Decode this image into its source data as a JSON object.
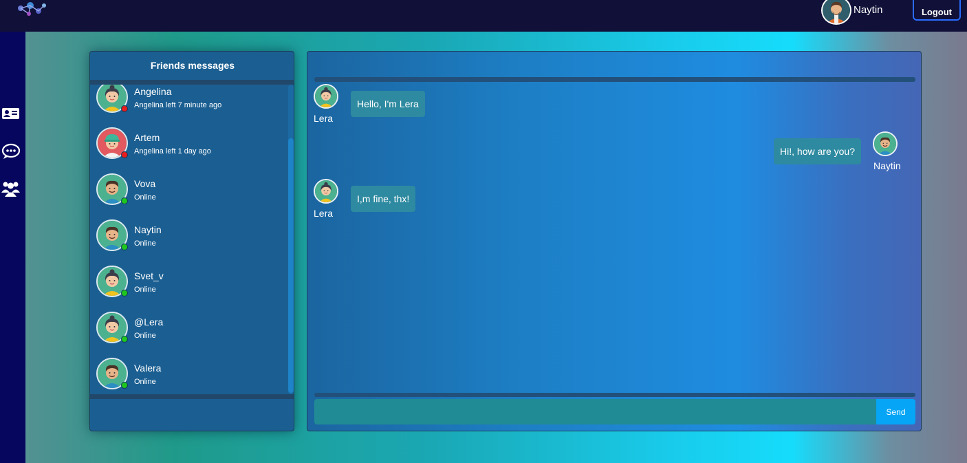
{
  "header": {
    "logo_icon": "network-logo-icon",
    "user_name": "Naytin",
    "logout_label": "Logout"
  },
  "sidebar": {
    "items": [
      {
        "icon": "contact-card-icon"
      },
      {
        "icon": "chat-bubble-icon"
      },
      {
        "icon": "users-group-icon"
      }
    ]
  },
  "friends": {
    "title": "Friends messages",
    "items": [
      {
        "name": "Angelina",
        "status": "Angelina left 7 minute ago",
        "online": false,
        "avatar": "girl"
      },
      {
        "name": "Artem",
        "status": "Angelina left 1 day ago",
        "online": false,
        "avatar": "cap"
      },
      {
        "name": "Vova",
        "status": "Online",
        "online": true,
        "avatar": "boy"
      },
      {
        "name": "Naytin",
        "status": "Online",
        "online": true,
        "avatar": "boy"
      },
      {
        "name": "Svet_v",
        "status": "Online",
        "online": true,
        "avatar": "girl"
      },
      {
        "name": "@Lera",
        "status": "Online",
        "online": true,
        "avatar": "girl"
      },
      {
        "name": "Valera",
        "status": "Online",
        "online": true,
        "avatar": "boy"
      }
    ]
  },
  "chat": {
    "messages": [
      {
        "author": "Lera",
        "text": "Hello, I'm Lera",
        "side": "left"
      },
      {
        "author": "Naytin",
        "text": "Hi!, how are you?",
        "side": "right"
      },
      {
        "author": "Lera",
        "text": "I,m fine, thx!",
        "side": "left"
      }
    ],
    "input_value": "",
    "send_label": "Send"
  },
  "colors": {
    "online": "#1ec61e",
    "offline": "#e81c1c",
    "accent": "#07a5f5"
  }
}
